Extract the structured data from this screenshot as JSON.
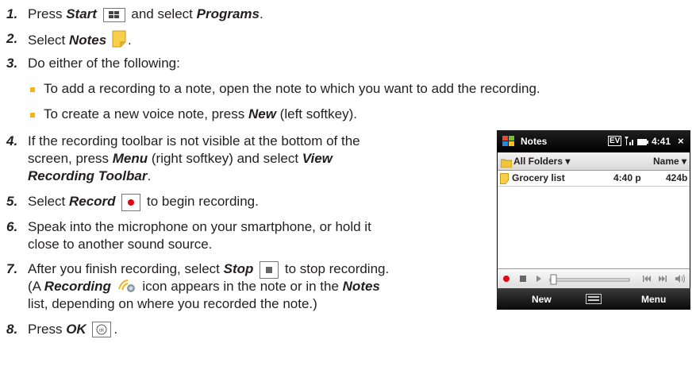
{
  "steps": [
    {
      "num": "1.",
      "text": [
        "Press ",
        "Start",
        " and select ",
        "Programs",
        "."
      ]
    },
    {
      "num": "2.",
      "text": [
        "Select ",
        "Notes",
        "."
      ]
    },
    {
      "num": "3.",
      "text": [
        "Do either of the following:"
      ]
    },
    {
      "num": "4.",
      "lines": [
        "If the recording toolbar is not visible at the bottom of the",
        "screen, press ",
        "Menu",
        " (right softkey) and select ",
        "View",
        "Recording Toolbar",
        "."
      ]
    },
    {
      "num": "5.",
      "text": [
        "Select ",
        "Record",
        " to begin recording."
      ]
    },
    {
      "num": "6.",
      "lines": [
        "Speak into the microphone on your smartphone, or hold it",
        "close to another sound source."
      ]
    },
    {
      "num": "7.",
      "lines": [
        "After you finish recording, select ",
        "Stop",
        " to stop recording.",
        "(A ",
        "Recording",
        " icon appears in the note or in the ",
        "Notes",
        "list, depending on where you recorded the note.)"
      ]
    },
    {
      "num": "8.",
      "text": [
        "Press ",
        "OK",
        "."
      ]
    }
  ],
  "bullets": [
    "To add a recording to a note, open the note to which you want to add the recording.",
    [
      "To create a new voice note, press ",
      "New",
      " (left softkey)."
    ]
  ],
  "phone": {
    "title": "Notes",
    "time": "4:41",
    "folder": "All Folders",
    "sort": "Name",
    "item_name": "Grocery list",
    "item_time": "4:40 p",
    "item_size": "424b",
    "left_softkey": "New",
    "right_softkey": "Menu",
    "ev": "EV"
  },
  "colors": {
    "bullet": "#f6b41a",
    "record": "#e30613",
    "note_icon": "#f9cf4a"
  }
}
